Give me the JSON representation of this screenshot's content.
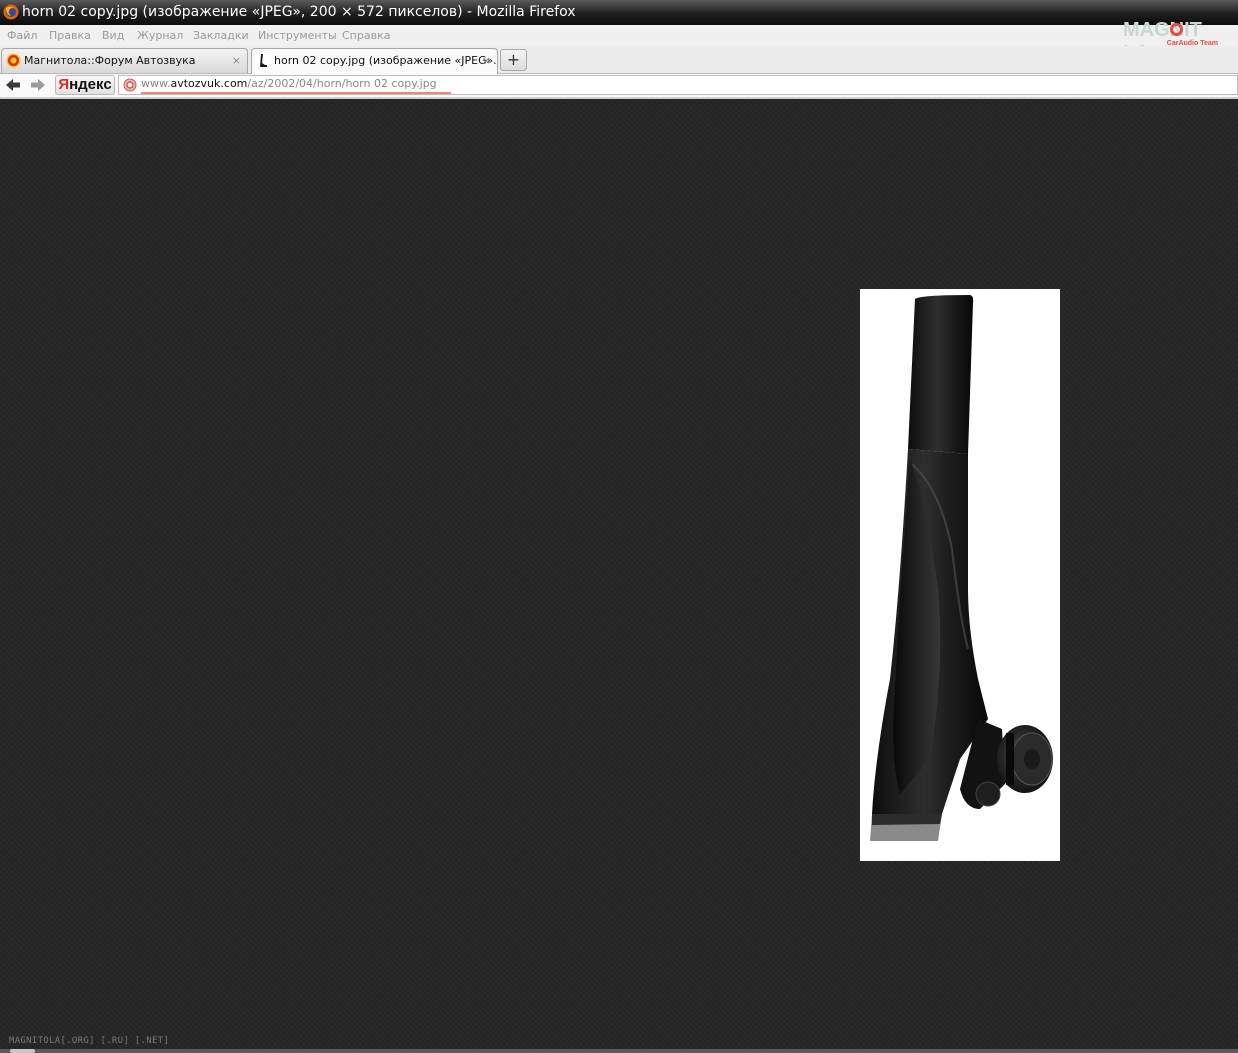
{
  "window": {
    "title": "horn 02 copy.jpg (изображение «JPEG», 200 × 572 пикселов) - Mozilla Firefox"
  },
  "menu": [
    "Файл",
    "Правка",
    "Вид",
    "Журнал",
    "Закладки",
    "Инструменты",
    "Справка"
  ],
  "logo": {
    "main": "MAGNIT  LA",
    "sub": "CarAudio Team"
  },
  "tabs": [
    {
      "label": "Магнитола::Форум Автозвука",
      "close": "×",
      "active": false
    },
    {
      "label": "horn 02 copy.jpg (изображение «JPEG»...",
      "close": "×",
      "active": true
    }
  ],
  "new_tab": "+",
  "toolbar": {
    "yandex_first": "Я",
    "yandex_rest": "ндекс"
  },
  "address": {
    "prefix": "www.",
    "domain": "avtozvuk.com",
    "path": "/az/2002/04/horn/horn 02 copy.jpg"
  },
  "image": {
    "caption": "horn 02 copy.jpg"
  },
  "footer": "MAGNITOLA[.ORG] [.RU] [.NET]",
  "icons": {
    "firefox": "firefox-icon",
    "back": "back-arrow-icon",
    "forward": "forward-arrow-icon",
    "site": "site-identity-icon"
  },
  "colors": {
    "viewer_bg": "#262626",
    "titlebar": "#1e1e1e",
    "accent": "#e52b1e"
  }
}
